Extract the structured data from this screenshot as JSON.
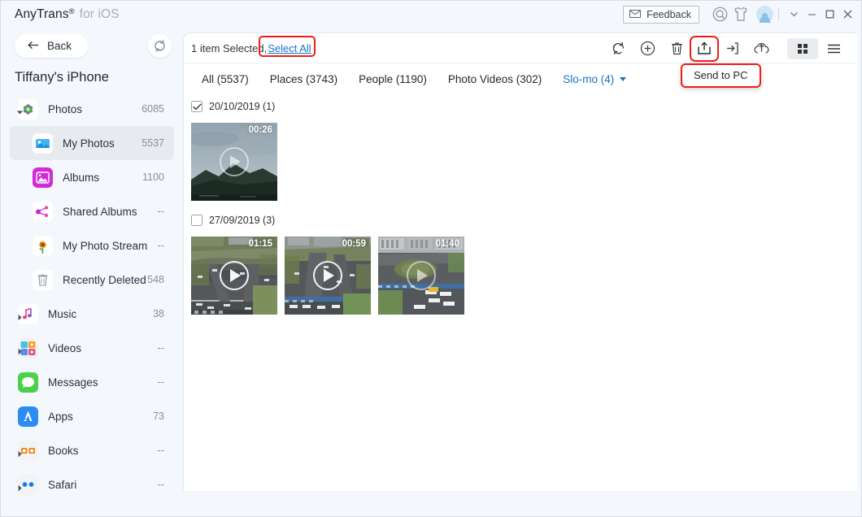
{
  "window": {
    "title_brand": "AnyTrans",
    "title_reg": "®",
    "title_suffix": "for iOS",
    "feedback_label": "Feedback",
    "controls": {
      "chevron": "chevron-down",
      "minimize": "minimize",
      "maximize": "maximize",
      "close": "close"
    }
  },
  "sidebar": {
    "back_label": "Back",
    "refresh_icon": "refresh-icon",
    "device_name": "Tiffany's iPhone",
    "items": [
      {
        "label": "Photos",
        "count": "6085",
        "icon": "photos-icon",
        "expanded": true,
        "child": false,
        "selected": false,
        "caret": "down"
      },
      {
        "label": "My Photos",
        "count": "5537",
        "icon": "my-photos-icon",
        "expanded": false,
        "child": true,
        "selected": true,
        "caret": ""
      },
      {
        "label": "Albums",
        "count": "1100",
        "icon": "albums-icon",
        "expanded": false,
        "child": true,
        "selected": false,
        "caret": ""
      },
      {
        "label": "Shared Albums",
        "count": "--",
        "icon": "shared-albums-icon",
        "expanded": false,
        "child": true,
        "selected": false,
        "caret": ""
      },
      {
        "label": "My Photo Stream",
        "count": "--",
        "icon": "photo-stream-icon",
        "expanded": false,
        "child": true,
        "selected": false,
        "caret": ""
      },
      {
        "label": "Recently Deleted",
        "count": "548",
        "icon": "trash-icon",
        "expanded": false,
        "child": true,
        "selected": false,
        "caret": ""
      },
      {
        "label": "Music",
        "count": "38",
        "icon": "music-icon",
        "expanded": false,
        "child": false,
        "selected": false,
        "caret": "right"
      },
      {
        "label": "Videos",
        "count": "--",
        "icon": "videos-icon",
        "expanded": false,
        "child": false,
        "selected": false,
        "caret": "right"
      },
      {
        "label": "Messages",
        "count": "--",
        "icon": "messages-icon",
        "expanded": false,
        "child": false,
        "selected": false,
        "caret": ""
      },
      {
        "label": "Apps",
        "count": "73",
        "icon": "apps-icon",
        "expanded": false,
        "child": false,
        "selected": false,
        "caret": ""
      },
      {
        "label": "Books",
        "count": "--",
        "icon": "books-icon",
        "expanded": false,
        "child": false,
        "selected": false,
        "caret": "right"
      },
      {
        "label": "Safari",
        "count": "--",
        "icon": "safari-icon",
        "expanded": false,
        "child": false,
        "selected": false,
        "caret": "right"
      }
    ]
  },
  "content": {
    "selection_text": "1 item Selected,",
    "select_all_label": "Select All",
    "tooltip_label": "Send to PC",
    "toolbar": [
      {
        "name": "sync-icon",
        "highlighted": false
      },
      {
        "name": "add-icon",
        "highlighted": false
      },
      {
        "name": "delete-icon",
        "highlighted": false
      },
      {
        "name": "send-to-pc-icon",
        "highlighted": true
      },
      {
        "name": "send-to-device-icon",
        "highlighted": false
      },
      {
        "name": "upload-cloud-icon",
        "highlighted": false
      }
    ],
    "view_modes": [
      {
        "name": "grid-view-icon",
        "active": true
      },
      {
        "name": "list-view-icon",
        "active": false
      }
    ],
    "tabs": [
      {
        "label": "All (5537)",
        "active": false,
        "caret": false
      },
      {
        "label": "Places (3743)",
        "active": false,
        "caret": false
      },
      {
        "label": "People (1190)",
        "active": false,
        "caret": false
      },
      {
        "label": "Photo Videos (302)",
        "active": false,
        "caret": false
      },
      {
        "label": "Slo-mo (4)",
        "active": true,
        "caret": true
      }
    ],
    "groups": [
      {
        "label": "20/10/2019 (1)",
        "checked": true,
        "items": [
          {
            "duration": "00:26",
            "selected": true,
            "scene": "mountain",
            "play": "dim"
          }
        ]
      },
      {
        "label": "27/09/2019 (3)",
        "checked": false,
        "items": [
          {
            "duration": "01:15",
            "selected": false,
            "scene": "city-a",
            "play": "bright"
          },
          {
            "duration": "00:59",
            "selected": false,
            "scene": "city-b",
            "play": "bright"
          },
          {
            "duration": "01:40",
            "selected": false,
            "scene": "city-c",
            "play": "dim"
          }
        ]
      }
    ]
  },
  "colors": {
    "accent_blue": "#1574c8",
    "selection_blue": "#2bb0f5",
    "highlight_red": "#f01c1c",
    "app_bg": "#f4f7fb"
  }
}
